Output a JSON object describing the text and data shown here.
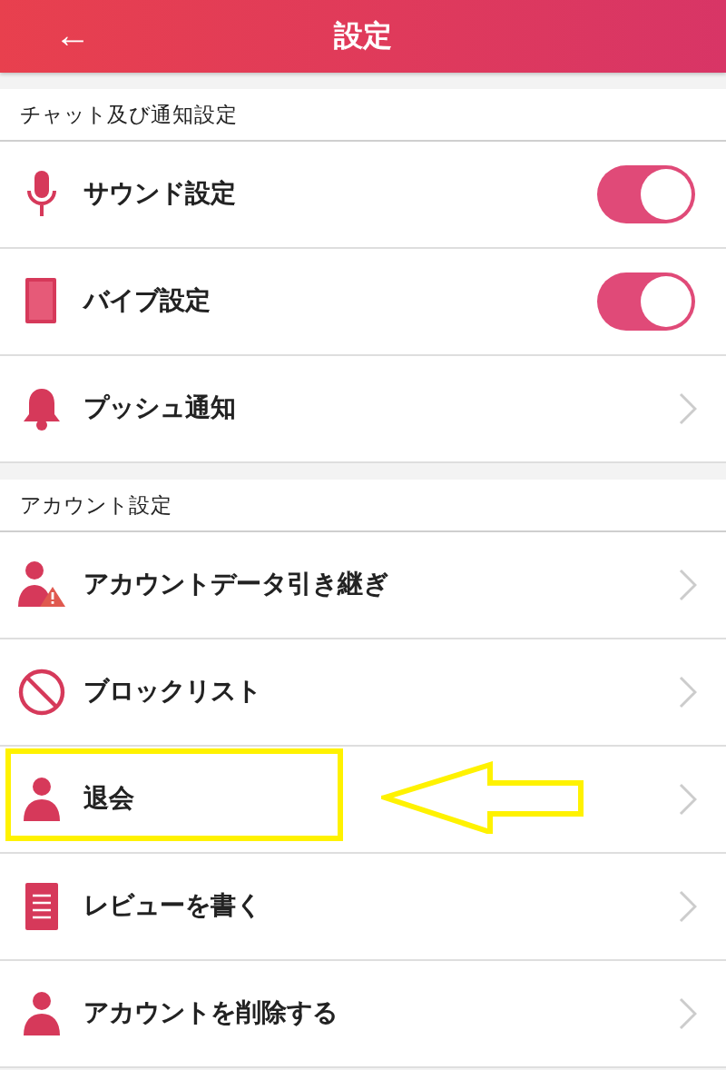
{
  "header": {
    "back": "←",
    "title": "設定"
  },
  "sections": [
    {
      "title": "チャット及び通知設定",
      "items": [
        {
          "kind": "toggle",
          "label": "サウンド設定",
          "on": true,
          "highlighted": false
        },
        {
          "kind": "toggle",
          "label": "バイブ設定",
          "on": true,
          "highlighted": false
        },
        {
          "kind": "link",
          "label": "プッシュ通知",
          "highlighted": false
        }
      ]
    },
    {
      "title": "アカウント設定",
      "items": [
        {
          "kind": "link",
          "label": "アカウントデータ引き継ぎ",
          "highlighted": false
        },
        {
          "kind": "link",
          "label": "ブロックリスト",
          "highlighted": false
        },
        {
          "kind": "link",
          "label": "退会",
          "highlighted": true
        },
        {
          "kind": "link",
          "label": "レビューを書く",
          "highlighted": false
        },
        {
          "kind": "link",
          "label": "アカウントを削除する",
          "highlighted": false
        }
      ]
    }
  ]
}
